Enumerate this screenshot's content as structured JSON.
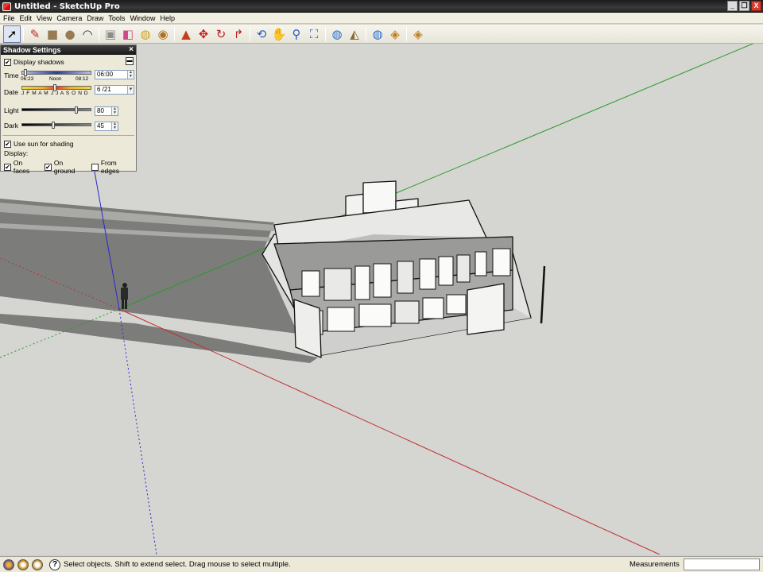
{
  "window": {
    "title": "Untitled - SketchUp Pro",
    "controls": [
      "_",
      "❐",
      "X"
    ]
  },
  "menu": [
    "File",
    "Edit",
    "View",
    "Camera",
    "Draw",
    "Tools",
    "Window",
    "Help"
  ],
  "toolbar": {
    "tools": [
      {
        "name": "select-tool-icon",
        "glyph": "➚",
        "color": "#000000"
      },
      {
        "name": "pencil-tool-icon",
        "glyph": "✎",
        "color": "#c0281c"
      },
      {
        "name": "rectangle-tool-icon",
        "glyph": "■",
        "color": "#9a7a52"
      },
      {
        "name": "circle-tool-icon",
        "glyph": "●",
        "color": "#9a7a52"
      },
      {
        "name": "arc-tool-icon",
        "glyph": "◠",
        "color": "#333333"
      },
      {
        "name": "make-component-icon",
        "glyph": "▣",
        "color": "#8c8c8c"
      },
      {
        "name": "eraser-tool-icon",
        "glyph": "◧",
        "color": "#d0488a"
      },
      {
        "name": "tape-measure-icon",
        "glyph": "◍",
        "color": "#d0a020"
      },
      {
        "name": "paint-bucket-icon",
        "glyph": "◉",
        "color": "#b07020"
      },
      {
        "name": "push-pull-icon",
        "glyph": "▲",
        "color": "#c0401c"
      },
      {
        "name": "move-tool-icon",
        "glyph": "✥",
        "color": "#c01c1c"
      },
      {
        "name": "rotate-tool-icon",
        "glyph": "↻",
        "color": "#c01c1c"
      },
      {
        "name": "offset-tool-icon",
        "glyph": "↱",
        "color": "#c01c1c"
      },
      {
        "name": "orbit-tool-icon",
        "glyph": "⟲",
        "color": "#2a5cc0"
      },
      {
        "name": "pan-tool-icon",
        "glyph": "✋",
        "color": "#2a5cc0"
      },
      {
        "name": "zoom-tool-icon",
        "glyph": "⚲",
        "color": "#2a5cc0"
      },
      {
        "name": "zoom-extents-icon",
        "glyph": "⛶",
        "color": "#2a5cc0"
      },
      {
        "name": "previous-view-icon",
        "glyph": "◍",
        "color": "#2a6cd0"
      },
      {
        "name": "next-view-icon",
        "glyph": "◭",
        "color": "#8a6a30"
      },
      {
        "name": "get-models-icon",
        "glyph": "◍",
        "color": "#2a6cd0"
      },
      {
        "name": "share-model-icon",
        "glyph": "◈",
        "color": "#c08020"
      },
      {
        "name": "components-icon",
        "glyph": "◈",
        "color": "#c08020"
      }
    ]
  },
  "shadow_settings": {
    "title": "Shadow Settings",
    "close": "×",
    "display_shadows_label": "Display shadows",
    "display_shadows": true,
    "time_label": "Time",
    "time_start": "06:23",
    "time_noon": "Noon",
    "time_end": "08:12",
    "time_value": "06:00",
    "time_fraction": 0.02,
    "date_label": "Date",
    "months": "J F M A M J J A S O N D",
    "date_value": "6 /21",
    "date_fraction": 0.47,
    "light_label": "Light",
    "light_value": "80",
    "light_fraction": 0.8,
    "dark_label": "Dark",
    "dark_value": "45",
    "dark_fraction": 0.45,
    "use_sun_label": "Use sun for shading",
    "use_sun": true,
    "display_label": "Display:",
    "on_faces_label": "On faces",
    "on_faces": true,
    "on_ground_label": "On ground",
    "on_ground": true,
    "from_edges_label": "From edges",
    "from_edges": false
  },
  "status": {
    "message": "Select objects. Shift to extend select. Drag mouse to select multiple.",
    "measurements_label": "Measurements",
    "measurements_value": ""
  },
  "colors": {
    "red_axis": "#c03030",
    "green_axis": "#2a9a2a",
    "blue_axis": "#2a2ad0",
    "ground": "#d5d5d2",
    "shadow": "#7c7c7a"
  }
}
